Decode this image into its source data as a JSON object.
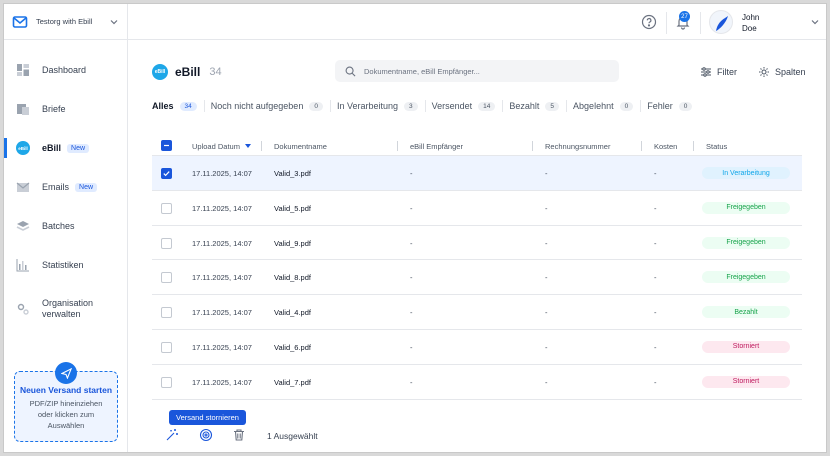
{
  "org": {
    "name": "Testorg with Ebill"
  },
  "user": {
    "first": "John",
    "last": "Doe",
    "notifications": "27"
  },
  "sidebar": {
    "items": [
      {
        "label": "Dashboard"
      },
      {
        "label": "Briefe"
      },
      {
        "label": "eBill",
        "badge": "New",
        "icon_text": "eBill"
      },
      {
        "label": "Emails",
        "badge": "New"
      },
      {
        "label": "Batches"
      },
      {
        "label": "Statistiken"
      },
      {
        "label_line1": "Organisation",
        "label_line2": "verwalten"
      }
    ],
    "upload": {
      "title": "Neuen Versand starten",
      "line1": "PDF/ZIP hineinziehen",
      "line2": "oder klicken zum",
      "line3": "Auswählen"
    }
  },
  "header": {
    "title": "eBill",
    "icon_text": "eBill",
    "count": "34",
    "search_placeholder": "Dokumentname, eBill Empfänger...",
    "filter_label": "Filter",
    "columns_label": "Spalten"
  },
  "tabs": [
    {
      "label": "Alles",
      "count": "34"
    },
    {
      "label": "Noch nicht aufgegeben",
      "count": "0"
    },
    {
      "label": "In Verarbeitung",
      "count": "3"
    },
    {
      "label": "Versendet",
      "count": "14"
    },
    {
      "label": "Bezahlt",
      "count": "5"
    },
    {
      "label": "Abgelehnt",
      "count": "0"
    },
    {
      "label": "Fehler",
      "count": "0"
    }
  ],
  "table": {
    "columns": [
      "Upload Datum",
      "Dokumentname",
      "eBill Empfänger",
      "Rechnungsnummer",
      "Kosten",
      "Status"
    ],
    "rows": [
      {
        "date": "17.11.2025, 14:07",
        "name": "Valid_3.pdf",
        "recipient": "-",
        "invoice": "-",
        "cost": "-",
        "status": "In Verarbeitung"
      },
      {
        "date": "17.11.2025, 14:07",
        "name": "Valid_5.pdf",
        "recipient": "-",
        "invoice": "-",
        "cost": "-",
        "status": "Freigegeben"
      },
      {
        "date": "17.11.2025, 14:07",
        "name": "Valid_9.pdf",
        "recipient": "-",
        "invoice": "-",
        "cost": "-",
        "status": "Freigegeben"
      },
      {
        "date": "17.11.2025, 14:07",
        "name": "Valid_8.pdf",
        "recipient": "-",
        "invoice": "-",
        "cost": "-",
        "status": "Freigegeben"
      },
      {
        "date": "17.11.2025, 14:07",
        "name": "Valid_4.pdf",
        "recipient": "-",
        "invoice": "-",
        "cost": "-",
        "status": "Bezahlt"
      },
      {
        "date": "17.11.2025, 14:07",
        "name": "Valid_6.pdf",
        "recipient": "-",
        "invoice": "-",
        "cost": "-",
        "status": "Storniert"
      },
      {
        "date": "17.11.2025, 14:07",
        "name": "Valid_7.pdf",
        "recipient": "-",
        "invoice": "-",
        "cost": "-",
        "status": "Storniert"
      }
    ]
  },
  "bottom": {
    "tooltip": "Versand stornieren",
    "selected_text": "1 Ausgewählt"
  },
  "colors": {
    "accent": "#1a56db",
    "ebill": "#1ea7e8"
  }
}
